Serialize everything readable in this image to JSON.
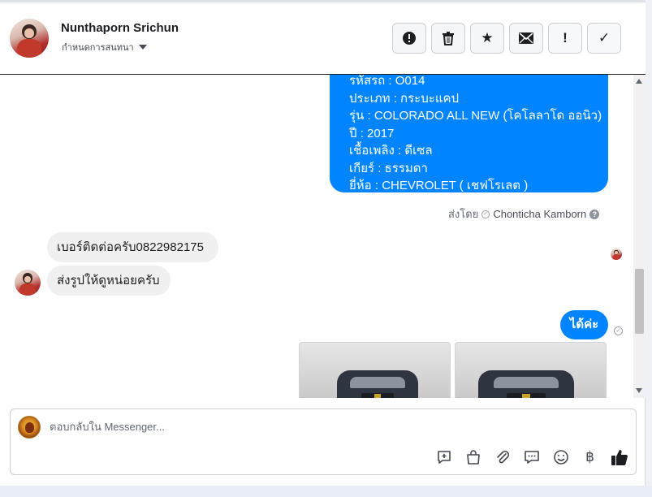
{
  "header": {
    "contact_name": "Nunthaporn Srichun",
    "assign_label": "กำหนดการสนทนา",
    "actions": [
      {
        "icon": "alert-circle-icon",
        "glyph": "!"
      },
      {
        "icon": "trash-icon",
        "glyph": ""
      },
      {
        "icon": "star-icon",
        "glyph": "★"
      },
      {
        "icon": "envelope-icon",
        "glyph": "✉"
      },
      {
        "icon": "exclamation-icon",
        "glyph": "!"
      },
      {
        "icon": "checkmark-icon",
        "glyph": "✓"
      }
    ]
  },
  "messages": {
    "car_details": [
      "รหัสรถ : O014",
      "ประเภท : กระบะแคป",
      "รุ่น : COLORADO ALL NEW (โคโลลาโด ออนิว)",
      "ปี : 2017",
      "เชื้อเพลิง : ดีเซล",
      "เกียร์ : ธรรมดา",
      "ยี่ห้อ : CHEVROLET ( เชฟโรเลต )"
    ],
    "sent_by_prefix": "ส่งโดย",
    "sent_by_name": "Chonticha Kamborn",
    "incoming_1": "เบอร์ติดต่อครับ0822982175",
    "incoming_2": "ส่งรูปให้ดูหน่อยครับ",
    "outgoing_reply": "ได้ค่ะ"
  },
  "composer": {
    "placeholder": "ตอบกลับใน Messenger...",
    "tools": [
      "chat-plus-icon",
      "shopping-bag-icon",
      "paperclip-icon",
      "speech-bubble-icon",
      "smiley-icon",
      "baht-icon",
      "thumbs-up-icon"
    ],
    "baht_glyph": "฿"
  },
  "colors": {
    "outgoing_bubble": "#0084ff",
    "incoming_bubble": "#f1f0f0"
  }
}
